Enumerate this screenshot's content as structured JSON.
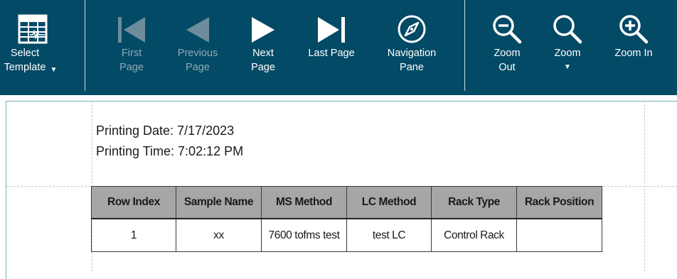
{
  "toolbar": {
    "select_template": {
      "line1": "Select",
      "line2": "Template"
    },
    "first_page": {
      "line1": "First",
      "line2": "Page"
    },
    "previous_page": {
      "line1": "Previous",
      "line2": "Page"
    },
    "next_page": {
      "line1": "Next",
      "line2": "Page"
    },
    "last_page": {
      "line1": "Last Page"
    },
    "navigation_pane": {
      "line1": "Navigation",
      "line2": "Pane"
    },
    "zoom_out": {
      "line1": "Zoom",
      "line2": "Out"
    },
    "zoom": {
      "line1": "Zoom"
    },
    "zoom_in": {
      "line1": "Zoom In"
    }
  },
  "report": {
    "printing_date": "Printing Date: 7/17/2023",
    "printing_time": "Printing Time: 7:02:12 PM",
    "columns": [
      "Row Index",
      "Sample Name",
      "MS Method",
      "LC Method",
      "Rack Type",
      "Rack Position"
    ],
    "rows": [
      [
        "1",
        "xx",
        "7600 tofms test",
        "test LC",
        "Control Rack",
        ""
      ]
    ]
  },
  "colors": {
    "toolbar_bg": "#034a66",
    "header_cell_bg": "#a6a6a6",
    "disabled_label": "#8fa9b5"
  }
}
